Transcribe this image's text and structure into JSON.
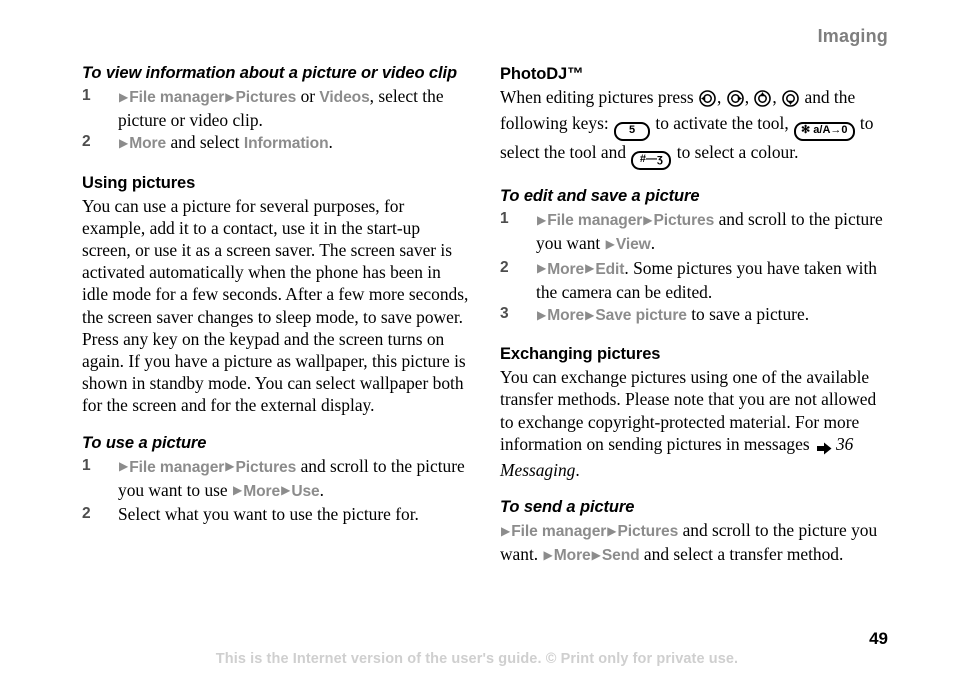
{
  "header": {
    "chapter": "Imaging"
  },
  "footer": {
    "page_number": "49",
    "note": "This is the Internet version of the user's guide. © Print only for private use."
  },
  "left_column": {
    "proc_view_info": {
      "heading": "To view information about a picture or video clip",
      "steps": [
        {
          "number": "1",
          "parts": [
            {
              "type": "arrow"
            },
            {
              "type": "menu",
              "text": "File manager"
            },
            {
              "type": "arrow"
            },
            {
              "type": "menu",
              "text": "Pictures"
            },
            {
              "type": "text",
              "text": " or "
            },
            {
              "type": "menu",
              "text": "Videos"
            },
            {
              "type": "text",
              "text": ", select the picture or video clip."
            }
          ]
        },
        {
          "number": "2",
          "parts": [
            {
              "type": "arrow"
            },
            {
              "type": "menu",
              "text": "More"
            },
            {
              "type": "text",
              "text": " and select "
            },
            {
              "type": "menu",
              "text": "Information"
            },
            {
              "type": "text",
              "text": "."
            }
          ]
        }
      ]
    },
    "section_using_pictures": {
      "heading": "Using pictures",
      "body": "You can use a picture for several purposes, for example, add it to a contact, use it in the start-up screen, or use it as a screen saver. The screen saver is activated automatically when the phone has been in idle mode for a few seconds. After a few more seconds, the screen saver changes to sleep mode, to save power. Press any key on the keypad and the screen turns on again. If you have a picture as wallpaper, this picture is shown in standby mode. You can select wallpaper both for the screen and for the external display."
    },
    "proc_use_picture": {
      "heading": "To use a picture",
      "steps": [
        {
          "number": "1",
          "parts": [
            {
              "type": "arrow"
            },
            {
              "type": "menu",
              "text": "File manager"
            },
            {
              "type": "arrow"
            },
            {
              "type": "menu",
              "text": "Pictures"
            },
            {
              "type": "text",
              "text": " and scroll to the picture you want to use "
            },
            {
              "type": "arrow"
            },
            {
              "type": "menu",
              "text": "More"
            },
            {
              "type": "arrow"
            },
            {
              "type": "menu",
              "text": "Use"
            },
            {
              "type": "text",
              "text": "."
            }
          ]
        },
        {
          "number": "2",
          "parts": [
            {
              "type": "text",
              "text": "Select what you want to use the picture for."
            }
          ]
        }
      ]
    }
  },
  "right_column": {
    "section_photodj": {
      "heading": "PhotoDJ™",
      "body_parts": [
        {
          "type": "text",
          "text": "When editing pictures press "
        },
        {
          "type": "key",
          "key": "nav-left"
        },
        {
          "type": "text",
          "text": ", "
        },
        {
          "type": "key",
          "key": "nav-right"
        },
        {
          "type": "text",
          "text": ", "
        },
        {
          "type": "key",
          "key": "nav-up"
        },
        {
          "type": "text",
          "text": ", "
        },
        {
          "type": "key",
          "key": "nav-down"
        },
        {
          "type": "text",
          "text": " and the following keys: "
        },
        {
          "type": "key",
          "key": "key-5",
          "label": "5"
        },
        {
          "type": "text",
          "text": " to activate the tool, "
        },
        {
          "type": "key",
          "key": "key-star",
          "label": "✻ a/A→0"
        },
        {
          "type": "text",
          "text": " to select the tool and "
        },
        {
          "type": "key",
          "key": "key-hash",
          "label": "#—ʒ"
        },
        {
          "type": "text",
          "text": " to select a colour."
        }
      ]
    },
    "proc_edit_save": {
      "heading": "To edit and save a picture",
      "steps": [
        {
          "number": "1",
          "parts": [
            {
              "type": "arrow"
            },
            {
              "type": "menu",
              "text": "File manager"
            },
            {
              "type": "arrow"
            },
            {
              "type": "menu",
              "text": "Pictures"
            },
            {
              "type": "text",
              "text": " and scroll to the picture you want "
            },
            {
              "type": "arrow"
            },
            {
              "type": "menu",
              "text": "View"
            },
            {
              "type": "text",
              "text": "."
            }
          ]
        },
        {
          "number": "2",
          "parts": [
            {
              "type": "arrow"
            },
            {
              "type": "menu",
              "text": "More"
            },
            {
              "type": "arrow"
            },
            {
              "type": "menu",
              "text": "Edit"
            },
            {
              "type": "text",
              "text": ". Some pictures you have taken with the camera can be edited."
            }
          ]
        },
        {
          "number": "3",
          "parts": [
            {
              "type": "arrow"
            },
            {
              "type": "menu",
              "text": "More"
            },
            {
              "type": "arrow"
            },
            {
              "type": "menu",
              "text": "Save picture"
            },
            {
              "type": "text",
              "text": " to save a picture."
            }
          ]
        }
      ]
    },
    "section_exchanging": {
      "heading": "Exchanging pictures",
      "body_parts": [
        {
          "type": "text",
          "text": "You can exchange pictures using one of the available transfer methods. Please note that you are not allowed to exchange copyright-protected material. For more information on sending pictures in messages "
        },
        {
          "type": "fatarrow"
        },
        {
          "type": "xref",
          "text": "36 Messaging"
        },
        {
          "type": "text",
          "text": "."
        }
      ]
    },
    "proc_send_picture": {
      "heading": "To send a picture",
      "unnumbered_step": {
        "parts": [
          {
            "type": "arrow"
          },
          {
            "type": "menu",
            "text": "File manager"
          },
          {
            "type": "arrow"
          },
          {
            "type": "menu",
            "text": "Pictures"
          },
          {
            "type": "text",
            "text": " and scroll to the picture you want. "
          },
          {
            "type": "arrow"
          },
          {
            "type": "menu",
            "text": "More"
          },
          {
            "type": "arrow"
          },
          {
            "type": "menu",
            "text": "Send"
          },
          {
            "type": "text",
            "text": " and select a transfer method."
          }
        ]
      }
    }
  }
}
